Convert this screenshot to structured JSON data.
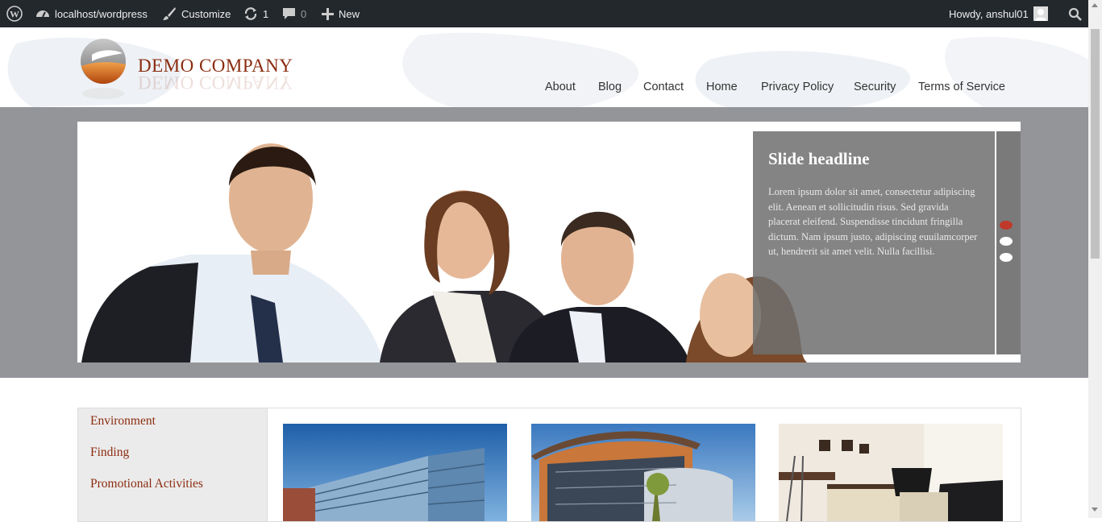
{
  "admin_bar": {
    "site": "localhost/wordpress",
    "customize": "Customize",
    "updates_count": "1",
    "comments_count": "0",
    "new_label": "New",
    "greeting": "Howdy, anshul01"
  },
  "header": {
    "company_name": "DEMO COMPANY",
    "nav": [
      "About",
      "Blog",
      "Contact",
      "Home",
      "Privacy Policy",
      "Security",
      "Terms of Service"
    ]
  },
  "slider": {
    "headline": "Slide headline",
    "text": "Lorem ipsum dolor sit amet, consectetur adipiscing elit. Aenean et sollicitudin risus. Sed gravida placerat eleifend. Suspendisse tincidunt fringilla dictum. Nam ipsum justo, adipiscing euuilamcorper ut, hendrerit sit amet velit. Nulla facillisi.",
    "slide_count": 3,
    "active_slide": 1
  },
  "sidebar": {
    "items": [
      "Environment",
      "Finding",
      "Promotional Activities"
    ]
  },
  "colors": {
    "admin_bar": "#23282d",
    "brand": "#8b2c10",
    "slider_band": "#949599",
    "active_dot": "#c0392b"
  },
  "icons": [
    "wordpress-icon",
    "dashboard-icon",
    "brush-icon",
    "refresh-icon",
    "comment-icon",
    "plus-icon",
    "avatar-icon",
    "search-icon"
  ]
}
